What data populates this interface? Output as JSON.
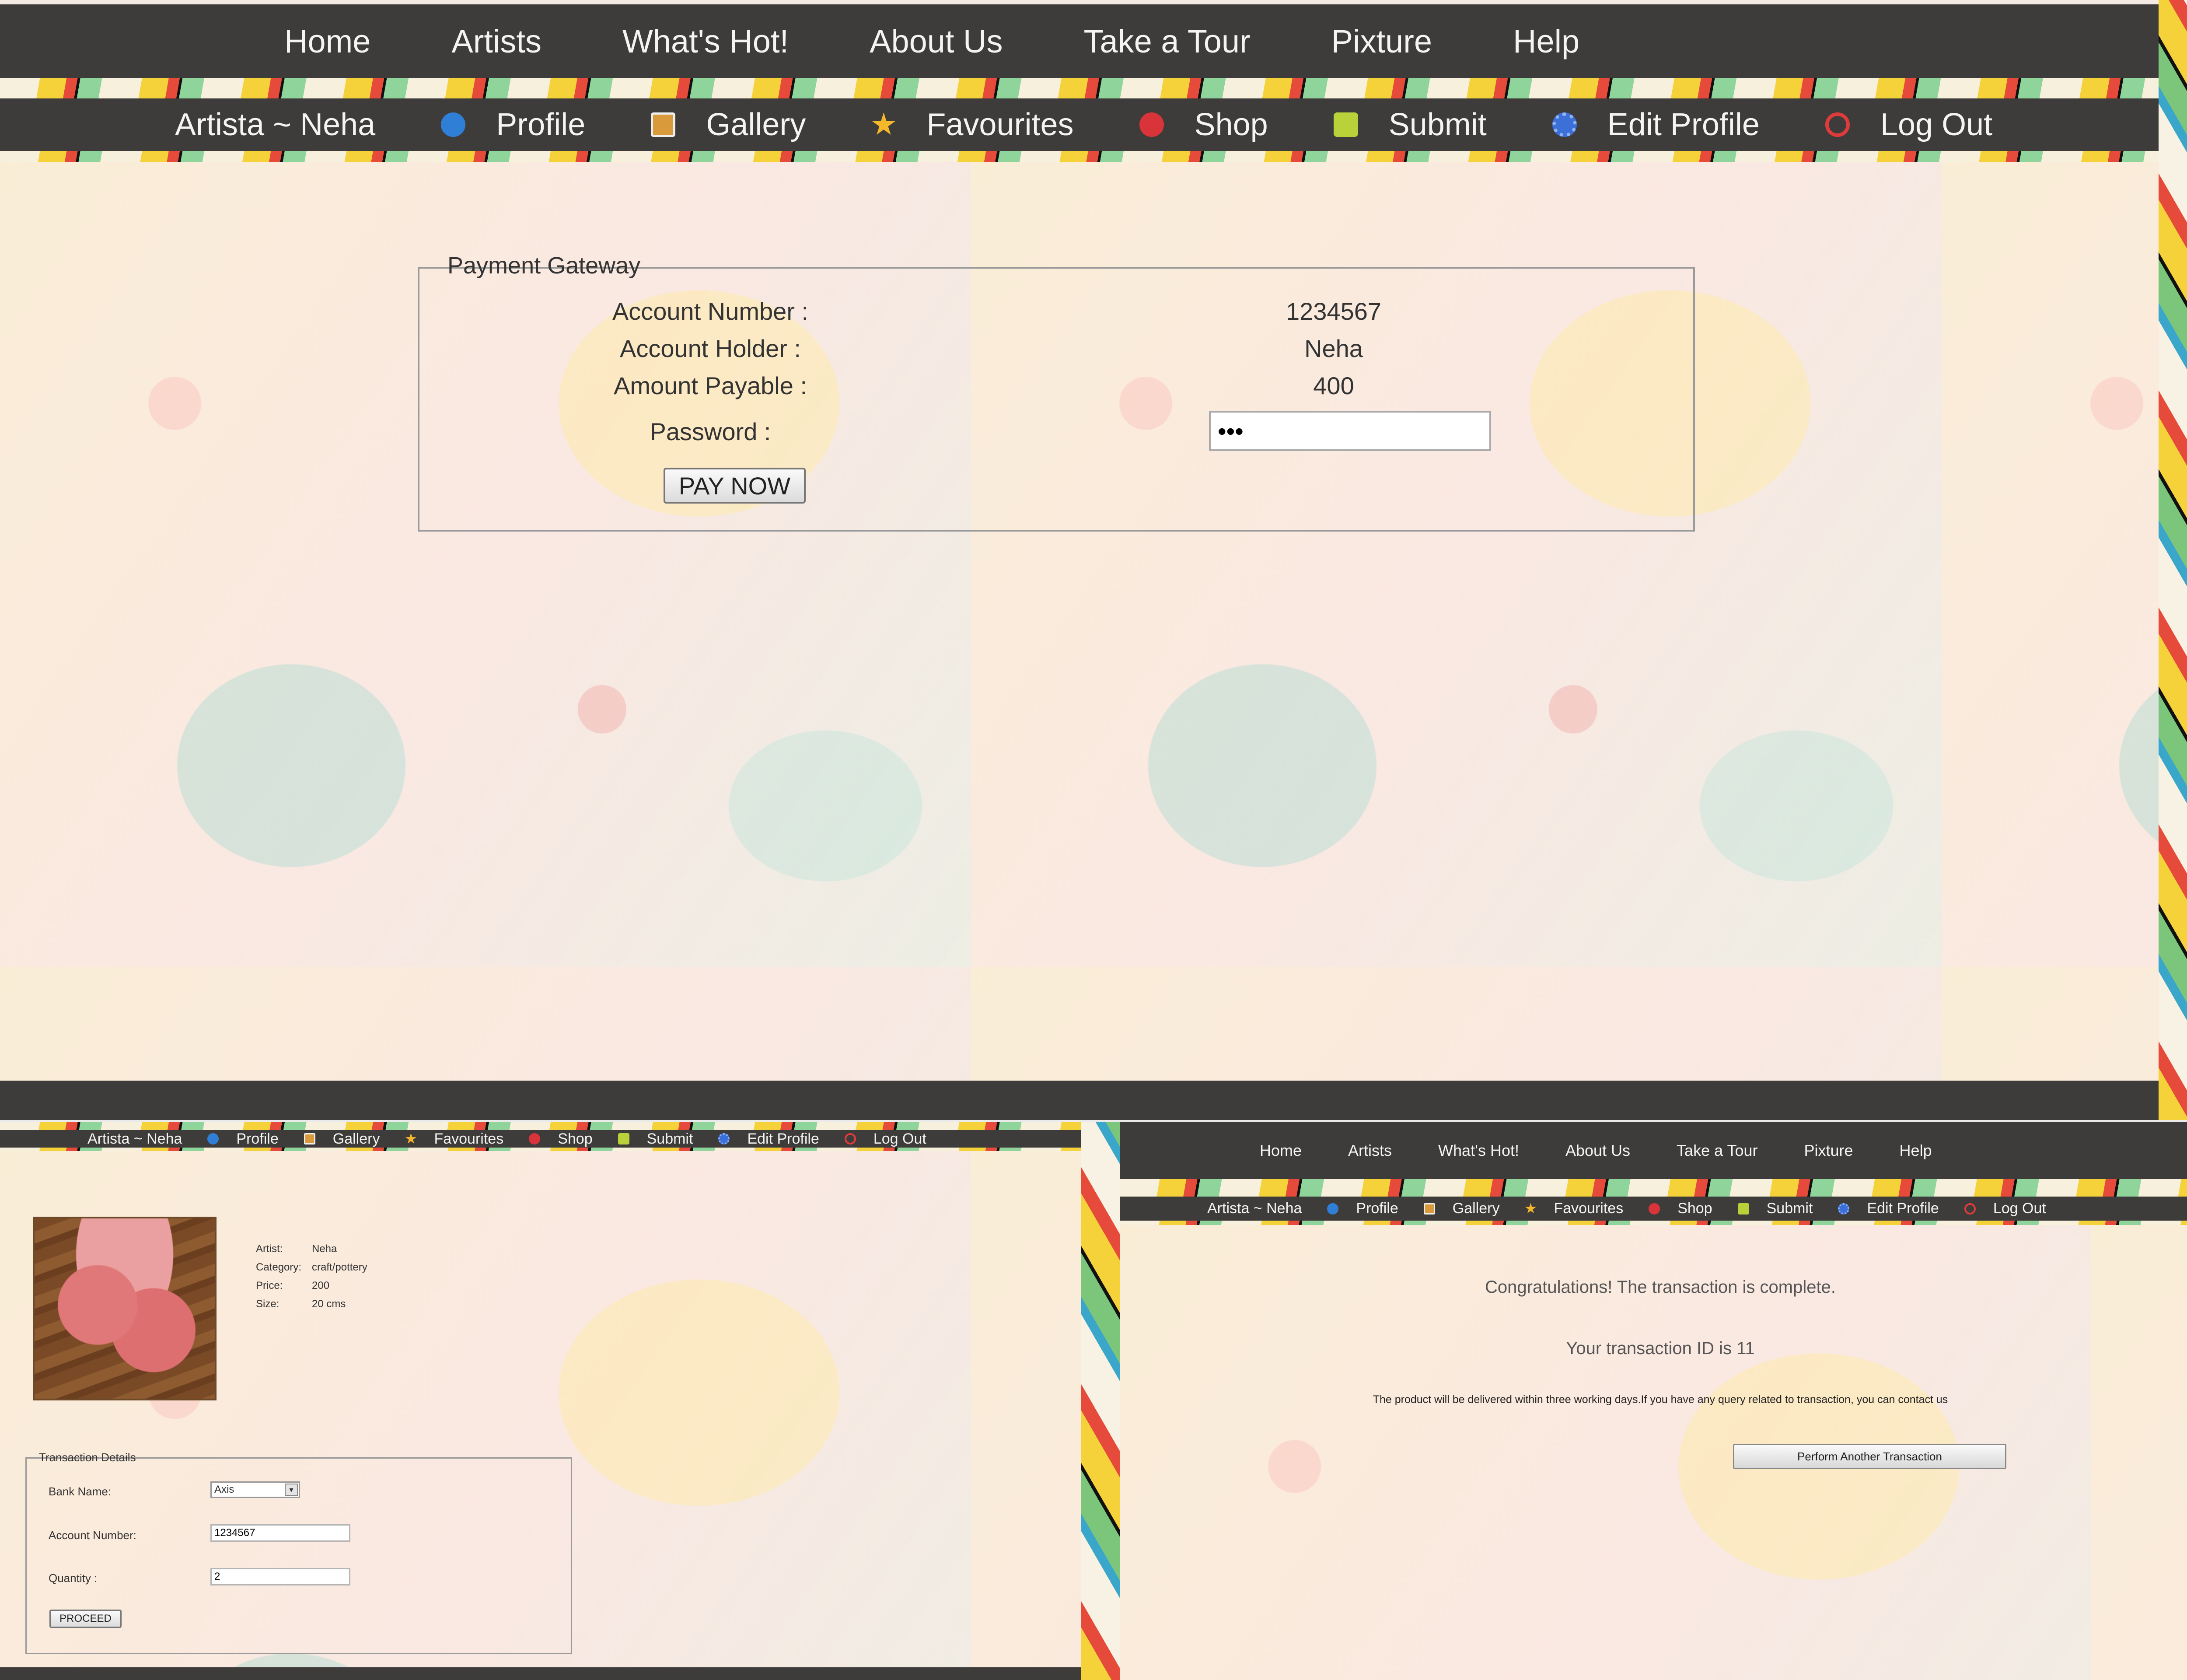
{
  "main_nav": {
    "home": "Home",
    "artists": "Artists",
    "whats_hot": "What's Hot!",
    "about_us": "About Us",
    "take_tour": "Take a Tour",
    "pixture": "Pixture",
    "help": "Help"
  },
  "user_nav": {
    "artist_name": "Artista ~ Neha",
    "profile": "Profile",
    "gallery": "Gallery",
    "favourites": "Favourites",
    "shop": "Shop",
    "submit": "Submit",
    "edit_profile": "Edit Profile",
    "log_out": "Log Out"
  },
  "payment_gateway": {
    "legend": "Payment Gateway",
    "account_number_label": "Account Number :",
    "account_number_value": "1234567",
    "account_holder_label": "Account Holder :",
    "account_holder_value": "Neha",
    "amount_payable_label": "Amount Payable :",
    "amount_payable_value": "400",
    "password_label": "Password :",
    "password_value": "•••",
    "pay_button": "PAY NOW"
  },
  "product": {
    "artist_label": "Artist:",
    "artist_value": "Neha",
    "category_label": "Category:",
    "category_value": "craft/pottery",
    "price_label": "Price:",
    "price_value": "200",
    "size_label": "Size:",
    "size_value": "20 cms"
  },
  "transaction_details": {
    "legend": "Transaction Details",
    "bank_name_label": "Bank Name:",
    "bank_name_value": "Axis",
    "account_number_label": "Account Number:",
    "account_number_value": "1234567",
    "quantity_label": "Quantity :",
    "quantity_value": "2",
    "proceed_button": "PROCEED"
  },
  "confirmation": {
    "congrats": "Congratulations! The transaction is complete.",
    "transaction_id": "Your transaction ID is 11",
    "delivery_note": "The product will be delivered within three working days.If you have any query related to transaction, you can contact us",
    "another_button": "Perform Another Transaction"
  },
  "colors": {
    "nav_bg": "#3e3c3b",
    "nav_text": "#f4f4f4",
    "page_bg": "#f8ece3"
  },
  "icons": {
    "profile": "info-icon",
    "gallery": "gallery-icon",
    "favourites": "star-icon",
    "shop": "cart-icon",
    "submit": "inbox-icon",
    "edit_profile": "gear-icon",
    "log_out": "power-icon"
  }
}
